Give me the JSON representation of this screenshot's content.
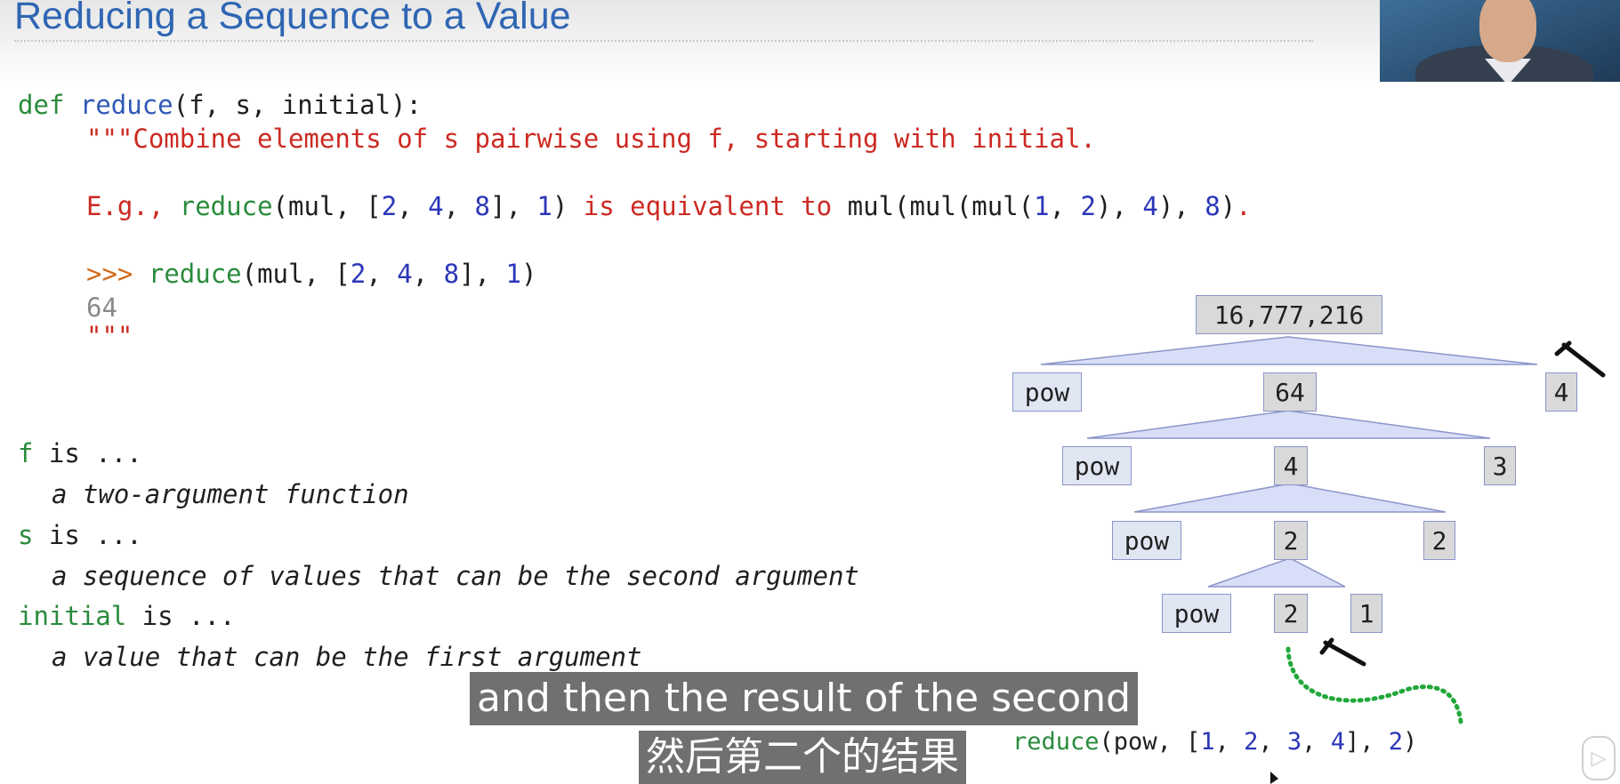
{
  "slide": {
    "title": "Reducing a Sequence to a Value"
  },
  "code": {
    "def_kw": "def",
    "func_name": "reduce",
    "signature": "(f, s, initial):",
    "docstring_line1": "\"\"\"Combine elements of s pairwise using f, starting with initial.",
    "eg_prefix": "E.g., ",
    "eg_reduce": "reduce",
    "eg_args_open": "(mul, [",
    "eg_n1": "2",
    "eg_sep1": ", ",
    "eg_n2": "4",
    "eg_sep2": ", ",
    "eg_n3": "8",
    "eg_args_mid": "], ",
    "eg_n4": "1",
    "eg_args_close": ")",
    "eg_text": " is equivalent to ",
    "eg_mul_open": "mul(mul(mul(",
    "eg_m1": "1",
    "eg_msep": ", ",
    "eg_m2": "2",
    "eg_mclose1": "), ",
    "eg_m3": "4",
    "eg_mclose2": "), ",
    "eg_m4": "8",
    "eg_mclose3": ")",
    "eg_period": ".",
    "prompt": ">>>",
    "doctest_func": "reduce",
    "doctest_open": "(mul, [",
    "d1": "2",
    "dsep1": ", ",
    "d2": "4",
    "dsep2": ", ",
    "d3": "8",
    "dmid": "], ",
    "d4": "1",
    "dclose": ")",
    "doctest_output": "64",
    "docstring_close": "\"\"\""
  },
  "params": [
    {
      "name": "f",
      "is": " is ...",
      "desc": "a two-argument function"
    },
    {
      "name": "s",
      "is": " is ...",
      "desc": "a sequence of values that can be the second argument"
    },
    {
      "name": "initial",
      "is": " is ...",
      "desc": "a value that can be the first argument"
    }
  ],
  "tree": {
    "root": "16,777,216",
    "levels": [
      {
        "fn": "pow",
        "mid": "64",
        "right": "4"
      },
      {
        "fn": "pow",
        "mid": "4",
        "right": "3"
      },
      {
        "fn": "pow",
        "mid": "2",
        "right": "2"
      },
      {
        "fn": "pow",
        "mid": "2",
        "right": "1"
      }
    ]
  },
  "call": {
    "func": "reduce",
    "open": "(pow, [",
    "n1": "1",
    "sep1": ", ",
    "n2": "2",
    "sep2": ", ",
    "n3": "3",
    "sep3": ", ",
    "n4": "4",
    "mid": "], ",
    "init": "2",
    "close": ")"
  },
  "subtitles": {
    "english": "and then the result of the second",
    "chinese": "然后第二个的结果"
  },
  "colors": {
    "title": "#2f66b3",
    "keyword": "#2a8b3c",
    "function": "#2f59b5",
    "string": "#cc2a22",
    "number": "#2b36b8",
    "prompt": "#d26b1b",
    "annotation_green": "#22a83a"
  },
  "icons": {
    "player": "play-icon"
  }
}
